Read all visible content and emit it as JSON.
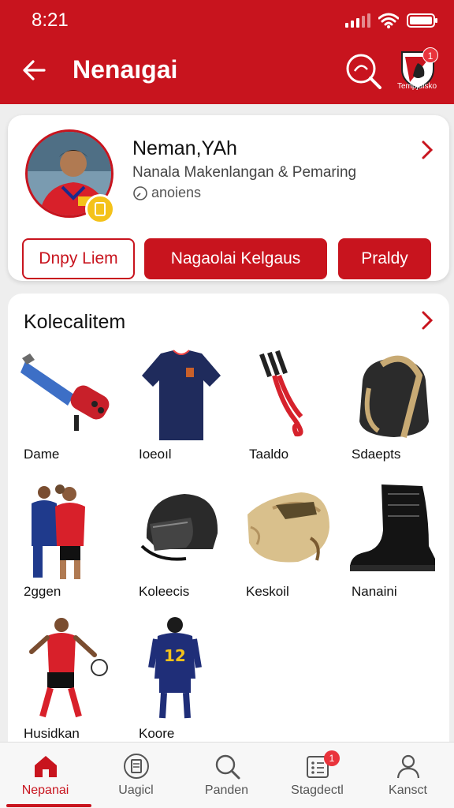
{
  "status_bar": {
    "time": "8:21"
  },
  "header": {
    "title": "Nenaıgai",
    "team_label": "Tempjdisko",
    "team_notification_count": "1",
    "accent_color": "#c8141e"
  },
  "profile": {
    "name": "Neman,YAh",
    "subtitle": "Nanala Makenlangan & Pemaring",
    "meta": "anoiens",
    "buttons": {
      "outline": "Dnpy Liem",
      "primary": "Nagaolai Kelgaus",
      "secondary": "Praldy"
    }
  },
  "collection": {
    "title": "Kolecalitem",
    "items": [
      {
        "label": "Dame",
        "icon": "launcher-icon"
      },
      {
        "label": "Ioeoıl",
        "icon": "jersey-icon"
      },
      {
        "label": "Taaldo",
        "icon": "cable-icon"
      },
      {
        "label": "Sdaepts",
        "icon": "backpack-icon"
      },
      {
        "label": "2ggen",
        "icon": "team-players-icon"
      },
      {
        "label": "Koleecis",
        "icon": "helmet-icon"
      },
      {
        "label": "Keskoil",
        "icon": "bedroll-icon"
      },
      {
        "label": "Nanaini",
        "icon": "boot-icon"
      },
      {
        "label": "Husidkan",
        "icon": "player-kick-icon"
      },
      {
        "label": "Koore",
        "icon": "player-back-icon"
      }
    ]
  },
  "bottom_nav": {
    "items": [
      {
        "label": "Nepanai",
        "icon": "home-icon",
        "active": true
      },
      {
        "label": "Uagicl",
        "icon": "document-icon"
      },
      {
        "label": "Panden",
        "icon": "search-icon"
      },
      {
        "label": "Stagdectl",
        "icon": "grid-icon",
        "badge": "1"
      },
      {
        "label": "Kansct",
        "icon": "profile-icon"
      }
    ]
  }
}
